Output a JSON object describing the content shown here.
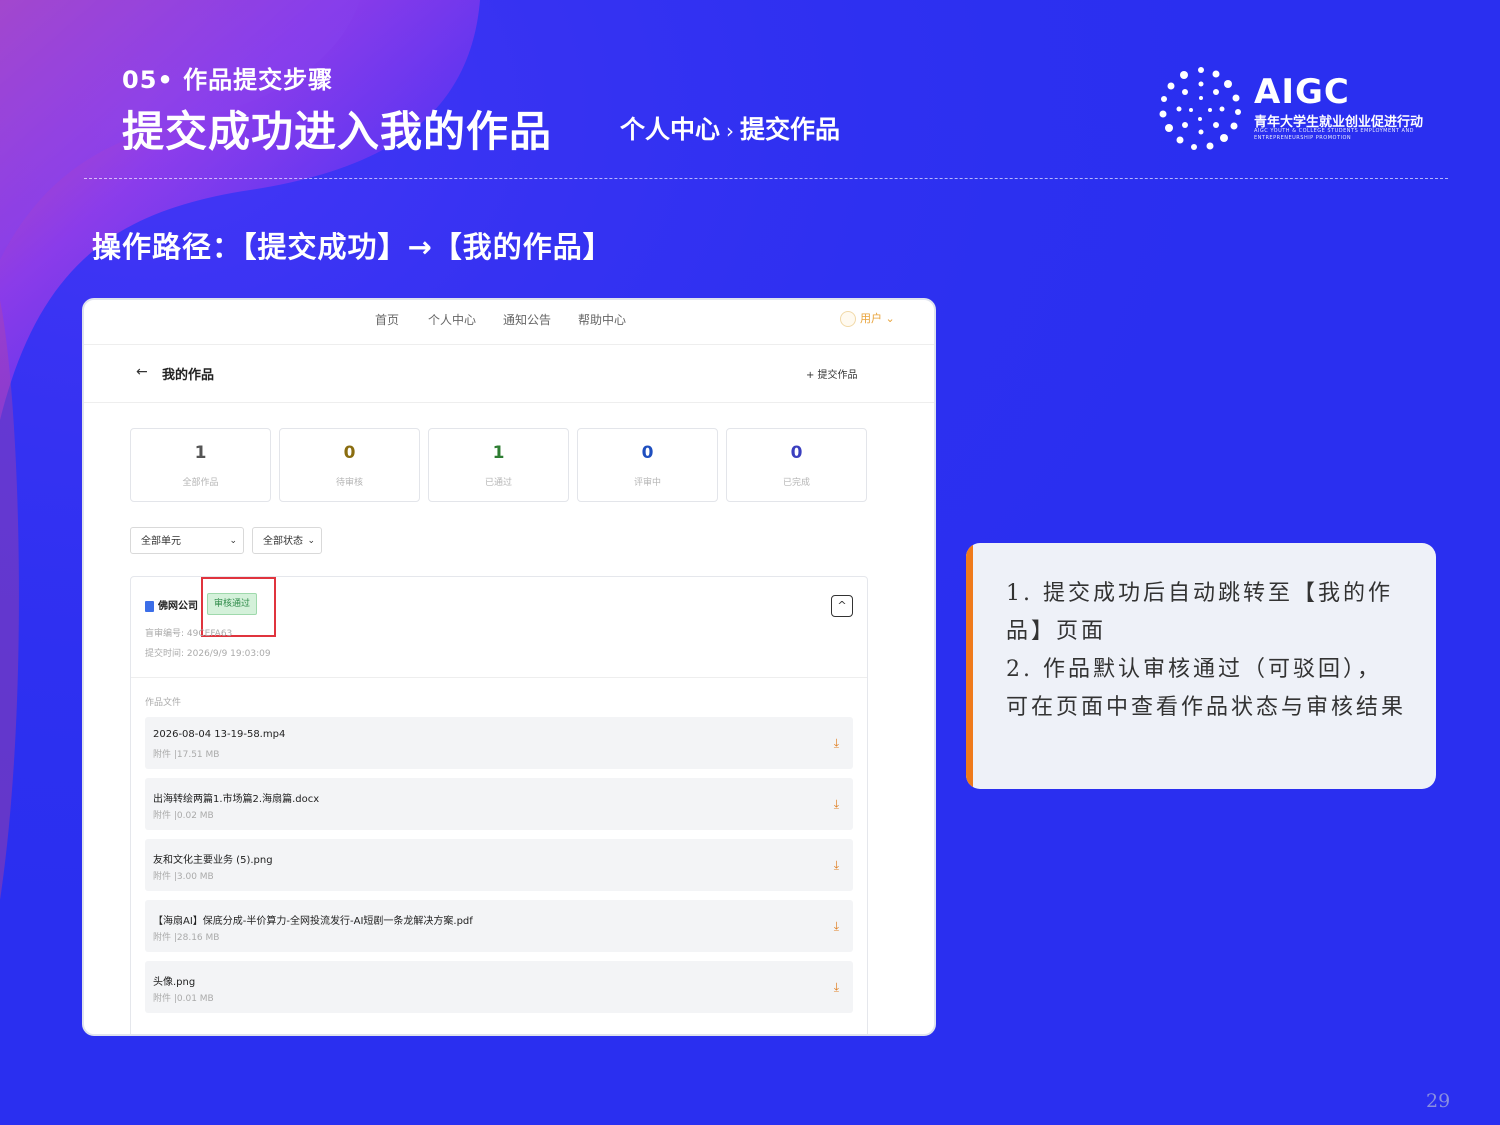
{
  "header": {
    "section": "05• 作品提交步骤",
    "title": "提交成功进入我的作品",
    "breadcrumb": [
      "个人中心",
      "›",
      "提交作品"
    ]
  },
  "logo": {
    "main": "AIGC",
    "sub": "青年大学生就业创业促进行动",
    "en": "AIGC YOUTH & COLLEGE STUDENTS EMPLOYMENT AND ENTREPRENEURSHIP PROMOTION"
  },
  "path_text": "操作路径：【提交成功】→【我的作品】",
  "screenshot": {
    "nav": [
      "首页",
      "个人中心",
      "通知公告",
      "帮助中心"
    ],
    "user": "用户 ⌄",
    "back_icon": "←",
    "page_title": "我的作品",
    "submit_button": "+ 提交作品",
    "stats": [
      {
        "value": "1",
        "label": "全部作品",
        "color": "#555555"
      },
      {
        "value": "0",
        "label": "待审核",
        "color": "#8a6d10"
      },
      {
        "value": "1",
        "label": "已通过",
        "color": "#2e7d32"
      },
      {
        "value": "0",
        "label": "评审中",
        "color": "#1f4fbf"
      },
      {
        "value": "0",
        "label": "已完成",
        "color": "#3b3fbf"
      }
    ],
    "filters": [
      "全部单元",
      "全部状态"
    ],
    "work": {
      "company": "佛网公司",
      "status": "审核通过",
      "id_line": "盲审编号: 49CEFA63",
      "time_line": "提交时间: 2026/9/9 19:03:09",
      "files_label": "作品文件",
      "collapse_icon": "^",
      "files": [
        {
          "name": "2026-08-04 13-19-58.mp4",
          "size": "附件 |17.51 MB"
        },
        {
          "name": "出海转绘两篇1.市场篇2.海扇篇.docx",
          "size": "附件 |0.02 MB"
        },
        {
          "name": "友和文化主要业务 (5).png",
          "size": "附件 |3.00 MB"
        },
        {
          "name": "【海扇AI】保底分成-半价算力-全网投流发行-AI短剧一条龙解决方案.pdf",
          "size": "附件 |28.16 MB"
        },
        {
          "name": "头像.png",
          "size": "附件 |0.01 MB"
        }
      ],
      "download_icon": "⤓"
    }
  },
  "note": {
    "lines": [
      "1. 提交成功后自动跳转至【我的作品】页面",
      "2. 作品默认审核通过（可驳回），可在页面中查看作品状态与审核结果"
    ]
  },
  "page_number": "29",
  "colors": {
    "background": "#2a2ff0",
    "accent_orange": "#ef7a1a",
    "highlight_red": "#e0343e"
  }
}
